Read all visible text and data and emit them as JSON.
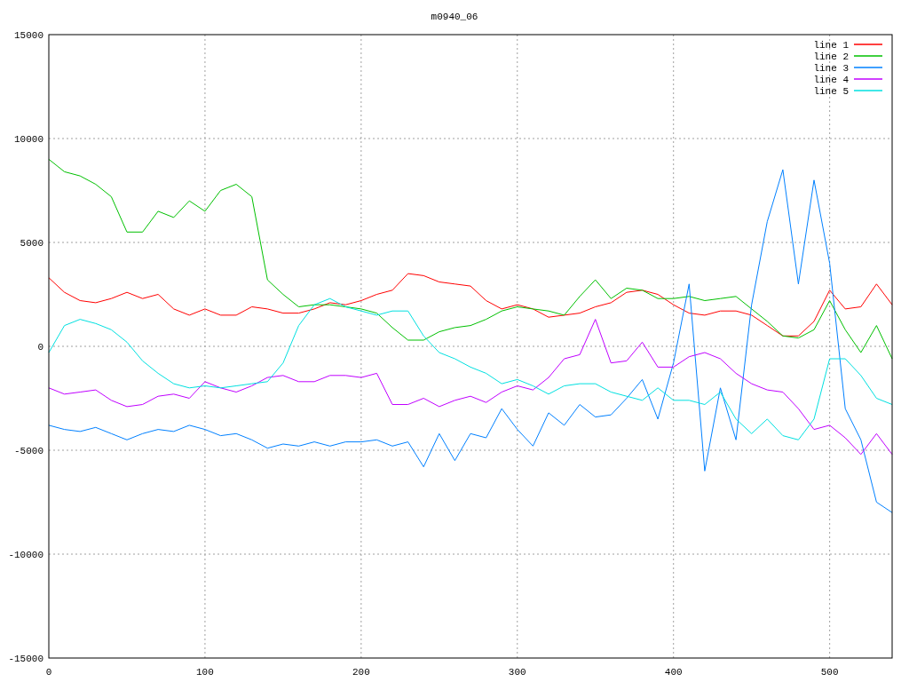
{
  "chart": {
    "chart_data": {
      "type": "line",
      "title": "m0940_06",
      "x": [
        0,
        10,
        20,
        30,
        40,
        50,
        60,
        70,
        80,
        90,
        100,
        110,
        120,
        130,
        140,
        150,
        160,
        170,
        180,
        190,
        200,
        210,
        220,
        230,
        240,
        250,
        260,
        270,
        280,
        290,
        300,
        310,
        320,
        330,
        340,
        350,
        360,
        370,
        380,
        390,
        400,
        410,
        420,
        430,
        440,
        450,
        460,
        470,
        480,
        490,
        500,
        510,
        520,
        530,
        540
      ],
      "series": [
        {
          "name": "line 1",
          "color": "#ff0000",
          "values": [
            3300,
            2600,
            2200,
            2100,
            2300,
            2600,
            2300,
            2500,
            1800,
            1500,
            1800,
            1500,
            1500,
            1900,
            1800,
            1600,
            1600,
            1800,
            2100,
            2000,
            2200,
            2500,
            2700,
            3500,
            3400,
            3100,
            3000,
            2900,
            2200,
            1800,
            2000,
            1800,
            1400,
            1500,
            1600,
            1900,
            2100,
            2600,
            2700,
            2500,
            2000,
            1600,
            1500,
            1700,
            1700,
            1500,
            1000,
            500,
            500,
            1200,
            2700,
            1800,
            1900,
            3000,
            2000
          ]
        },
        {
          "name": "line 2",
          "color": "#00c000",
          "values": [
            9000,
            8400,
            8200,
            7800,
            7200,
            5500,
            5500,
            6500,
            6200,
            7000,
            6500,
            7500,
            7800,
            7200,
            3200,
            2500,
            1900,
            2000,
            2000,
            1900,
            1800,
            1600,
            900,
            300,
            300,
            700,
            900,
            1000,
            1300,
            1700,
            1900,
            1800,
            1700,
            1500,
            2400,
            3200,
            2300,
            2800,
            2700,
            2300,
            2300,
            2400,
            2200,
            2300,
            2400,
            1800,
            1200,
            500,
            400,
            800,
            2200,
            800,
            -300,
            1000,
            -600
          ]
        },
        {
          "name": "line 3",
          "color": "#0080ff",
          "values": [
            -3800,
            -4000,
            -4100,
            -3900,
            -4200,
            -4500,
            -4200,
            -4000,
            -4100,
            -3800,
            -4000,
            -4300,
            -4200,
            -4500,
            -4900,
            -4700,
            -4800,
            -4600,
            -4800,
            -4600,
            -4600,
            -4500,
            -4800,
            -4600,
            -5800,
            -4200,
            -5500,
            -4200,
            -4400,
            -3000,
            -4000,
            -4800,
            -3200,
            -3800,
            -2800,
            -3400,
            -3300,
            -2500,
            -1600,
            -3500,
            -800,
            3000,
            -6000,
            -2000,
            -4500,
            2000,
            6000,
            8500,
            3000,
            8000,
            4000,
            -3000,
            -4500,
            -7500,
            -8000
          ]
        },
        {
          "name": "line 4",
          "color": "#c000ff",
          "values": [
            -2000,
            -2300,
            -2200,
            -2100,
            -2600,
            -2900,
            -2800,
            -2400,
            -2300,
            -2500,
            -1700,
            -2000,
            -2200,
            -1900,
            -1500,
            -1400,
            -1700,
            -1700,
            -1400,
            -1400,
            -1500,
            -1300,
            -2800,
            -2800,
            -2500,
            -2900,
            -2600,
            -2400,
            -2700,
            -2200,
            -1900,
            -2100,
            -1500,
            -600,
            -400,
            1300,
            -800,
            -700,
            200,
            -1000,
            -1000,
            -500,
            -300,
            -600,
            -1300,
            -1800,
            -2100,
            -2200,
            -3000,
            -4000,
            -3800,
            -4400,
            -5200,
            -4200,
            -5200
          ]
        },
        {
          "name": "line 5",
          "color": "#00e0e0",
          "values": [
            -300,
            1000,
            1300,
            1100,
            800,
            200,
            -700,
            -1300,
            -1800,
            -2000,
            -1900,
            -2000,
            -1900,
            -1800,
            -1700,
            -800,
            1000,
            2000,
            2300,
            1900,
            1700,
            1500,
            1700,
            1700,
            500,
            -300,
            -600,
            -1000,
            -1300,
            -1800,
            -1600,
            -1900,
            -2300,
            -1900,
            -1800,
            -1800,
            -2200,
            -2400,
            -2600,
            -2000,
            -2600,
            -2600,
            -2800,
            -2200,
            -3500,
            -4200,
            -3500,
            -4300,
            -4500,
            -3500,
            -600,
            -600,
            -1400,
            -2500,
            -2800
          ]
        }
      ],
      "grid": true,
      "legend": true,
      "xlim": [
        0,
        540
      ],
      "ylim": [
        -15000,
        15000
      ],
      "xticks": [
        0,
        100,
        200,
        300,
        400,
        500
      ],
      "yticks": [
        -15000,
        -10000,
        -5000,
        0,
        5000,
        10000,
        15000
      ]
    }
  }
}
